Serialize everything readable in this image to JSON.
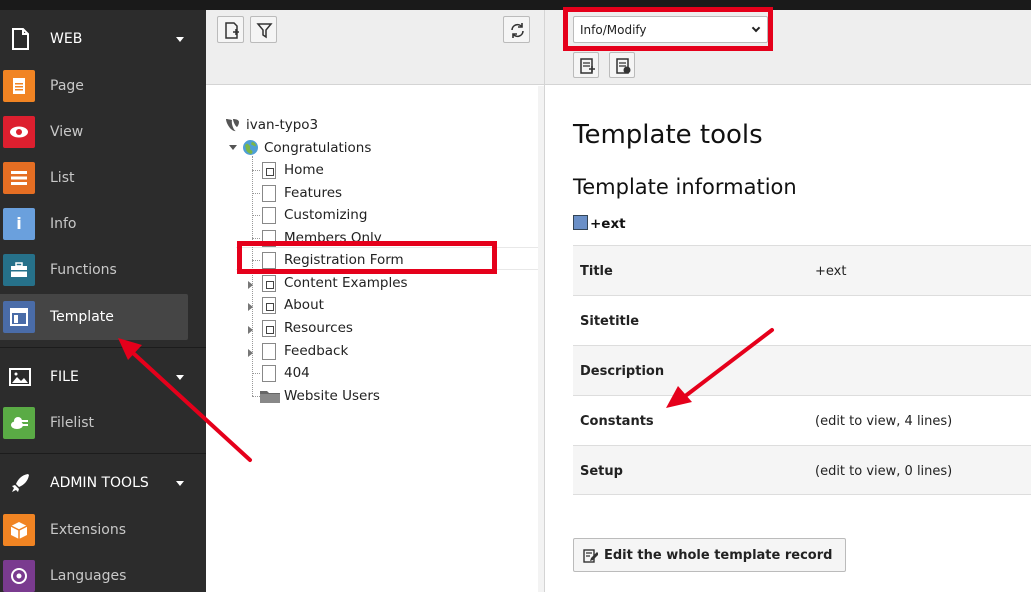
{
  "sidebar": {
    "groups": [
      {
        "label": "WEB",
        "icon": "document-icon"
      },
      {
        "label": "FILE",
        "icon": "image-icon"
      },
      {
        "label": "ADMIN TOOLS",
        "icon": "rocket-icon"
      }
    ],
    "web_modules": [
      {
        "label": "Page",
        "icon": "page-icon",
        "color": "#f18423"
      },
      {
        "label": "View",
        "icon": "eye-icon",
        "color": "#dd1f2f"
      },
      {
        "label": "List",
        "icon": "list-icon",
        "color": "#e56e23"
      },
      {
        "label": "Info",
        "icon": "info-icon",
        "color": "#6aa0dd"
      },
      {
        "label": "Functions",
        "icon": "briefcase-icon",
        "color": "#26718a"
      },
      {
        "label": "Template",
        "icon": "template-icon",
        "color": "#4a6ca8",
        "active": true
      }
    ],
    "file_modules": [
      {
        "label": "Filelist",
        "icon": "cloud-icon",
        "color": "#5aab45"
      }
    ],
    "admin_modules": [
      {
        "label": "Extensions",
        "icon": "box-icon",
        "color": "#f18423"
      },
      {
        "label": "Languages",
        "icon": "globe-icon",
        "color": "#7a3b8f"
      }
    ]
  },
  "tree": {
    "toolbar": [
      "new-page-icon",
      "filter-icon",
      "refresh-icon"
    ],
    "root": "ivan-typo3",
    "site": "Congratulations",
    "pages": [
      {
        "label": "Home"
      },
      {
        "label": "Features"
      },
      {
        "label": "Customizing"
      },
      {
        "label": "Members Only"
      },
      {
        "label": "Registration Form"
      },
      {
        "label": "Content Examples"
      },
      {
        "label": "About"
      },
      {
        "label": "Resources"
      },
      {
        "label": "Feedback"
      },
      {
        "label": "404"
      },
      {
        "label": "Website Users"
      }
    ]
  },
  "content": {
    "function_select": "Info/Modify",
    "heading": "Template tools",
    "subheading": "Template information",
    "template_name": "+ext",
    "rows": [
      {
        "label": "Title",
        "value": "+ext"
      },
      {
        "label": "Sitetitle",
        "value": ""
      },
      {
        "label": "Description",
        "value": ""
      },
      {
        "label": "Constants",
        "value": "(edit to view, 4 lines)"
      },
      {
        "label": "Setup",
        "value": "(edit to view, 0 lines)"
      }
    ],
    "edit_button": "Edit the whole template record"
  },
  "annotation_color": "#e5001b"
}
